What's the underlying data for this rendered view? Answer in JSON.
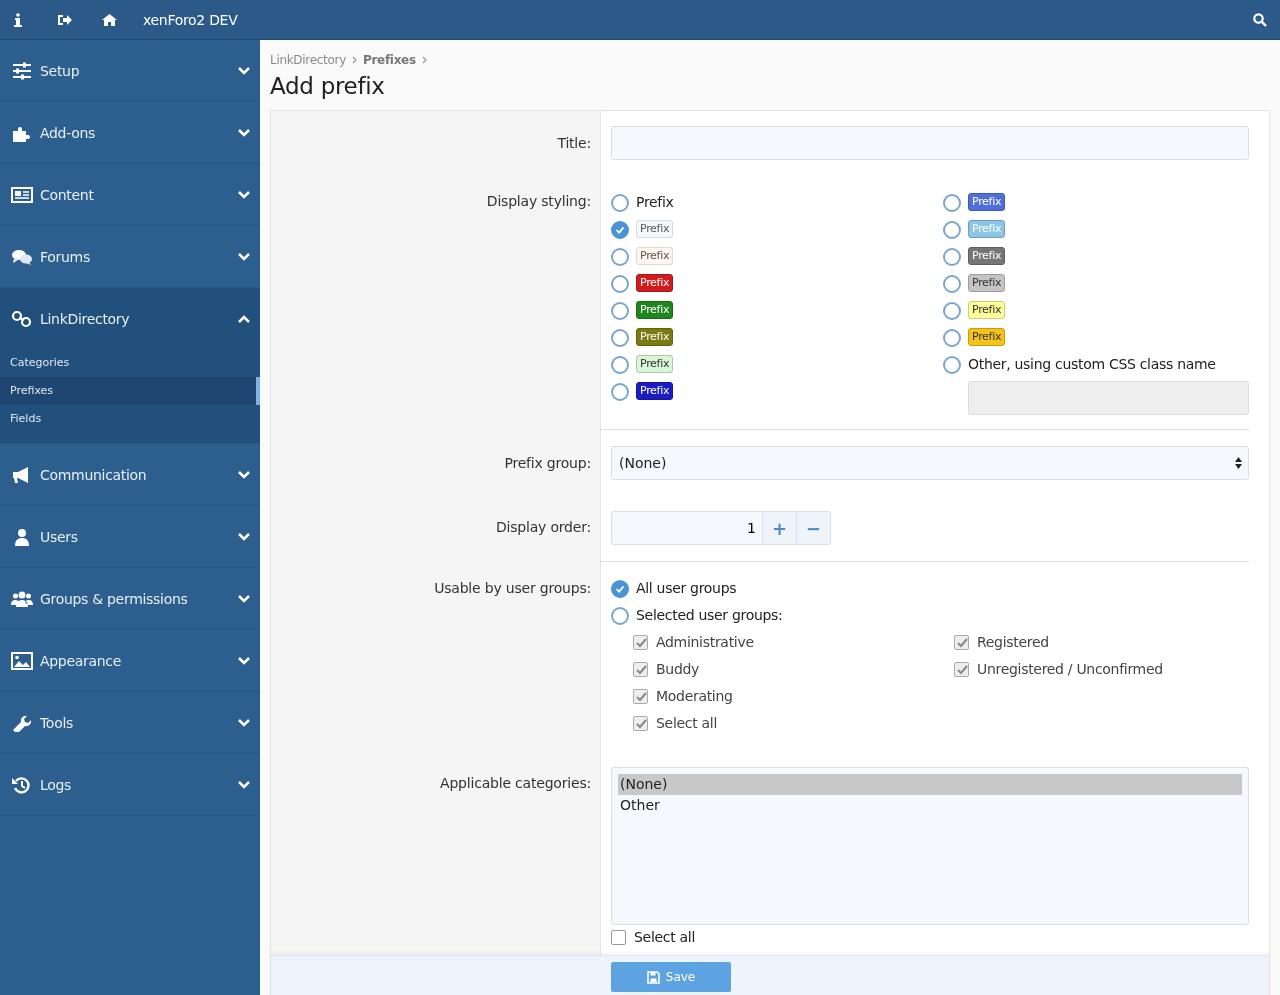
{
  "top_bar": {
    "title": "xenForo2 DEV"
  },
  "sidebar": {
    "items": [
      {
        "label": "Setup",
        "expanded": false
      },
      {
        "label": "Add-ons",
        "expanded": false
      },
      {
        "label": "Content",
        "expanded": false
      },
      {
        "label": "Forums",
        "expanded": false
      },
      {
        "label": "LinkDirectory",
        "expanded": true,
        "children": [
          {
            "label": "Categories",
            "selected": false
          },
          {
            "label": "Prefixes",
            "selected": true
          },
          {
            "label": "Fields",
            "selected": false
          }
        ]
      },
      {
        "label": "Communication",
        "expanded": false
      },
      {
        "label": "Users",
        "expanded": false
      },
      {
        "label": "Groups & permissions",
        "expanded": false
      },
      {
        "label": "Appearance",
        "expanded": false
      },
      {
        "label": "Tools",
        "expanded": false
      },
      {
        "label": "Logs",
        "expanded": false
      }
    ]
  },
  "breadcrumb": [
    {
      "label": "LinkDirectory",
      "current": false
    },
    {
      "label": "Prefixes",
      "current": true
    }
  ],
  "page_title": "Add prefix",
  "form": {
    "title": {
      "label": "Title:"
    },
    "display_styling": {
      "label": "Display styling:",
      "columns": [
        [
          {
            "kind": "plain",
            "text": "Prefix",
            "selected": false
          },
          {
            "kind": "light",
            "text": "Prefix",
            "color": "#f3f7fc",
            "selected": true
          },
          {
            "kind": "light",
            "text": "Prefix",
            "color": "#fff6ec",
            "selected": false
          },
          {
            "kind": "label",
            "text": "Prefix",
            "color": "#d21b1b",
            "selected": false
          },
          {
            "kind": "label",
            "text": "Prefix",
            "color": "#1f861f",
            "selected": false
          },
          {
            "kind": "label",
            "text": "Prefix",
            "color": "#7a7a12",
            "selected": false
          },
          {
            "kind": "label-dark",
            "text": "Prefix",
            "color": "#d9f6d9",
            "selected": false
          },
          {
            "kind": "label",
            "text": "Prefix",
            "color": "#1c1cc4",
            "selected": false
          }
        ],
        [
          {
            "kind": "label",
            "text": "Prefix",
            "color": "#4f6fdc",
            "selected": false
          },
          {
            "kind": "label",
            "text": "Prefix",
            "color": "#8cc6e6",
            "selected": false
          },
          {
            "kind": "label",
            "text": "Prefix",
            "color": "#767676",
            "selected": false
          },
          {
            "kind": "label-dark",
            "text": "Prefix",
            "color": "#c4c4c4",
            "selected": false
          },
          {
            "kind": "label-dark",
            "text": "Prefix",
            "color": "#ffff99",
            "selected": false
          },
          {
            "kind": "label-dark",
            "text": "Prefix",
            "color": "#f4c419",
            "selected": false
          },
          {
            "kind": "other",
            "text": "Other, using custom CSS class name",
            "selected": false
          }
        ]
      ]
    },
    "prefix_group": {
      "label": "Prefix group:",
      "value": "(None)"
    },
    "display_order": {
      "label": "Display order:",
      "value": "1",
      "plus": "+",
      "minus": "−"
    },
    "usable_by": {
      "label": "Usable by user groups:",
      "options": [
        {
          "text": "All user groups",
          "selected": true
        },
        {
          "text": "Selected user groups:",
          "selected": false
        }
      ],
      "groups": [
        [
          {
            "text": "Administrative",
            "checked": true,
            "disabled": true
          },
          {
            "text": "Buddy",
            "checked": true,
            "disabled": true
          },
          {
            "text": "Moderating",
            "checked": true,
            "disabled": true
          },
          {
            "text": "Select all",
            "checked": true,
            "disabled": true
          }
        ],
        [
          {
            "text": "Registered",
            "checked": true,
            "disabled": true
          },
          {
            "text": "Unregistered / Unconfirmed",
            "checked": true,
            "disabled": true
          }
        ]
      ]
    },
    "applicable_categories": {
      "label": "Applicable categories:",
      "options": [
        {
          "text": "(None)",
          "selected": true
        },
        {
          "text": "Other",
          "selected": false
        }
      ],
      "select_all": {
        "text": "Select all",
        "checked": false
      }
    },
    "save_button": "Save"
  }
}
